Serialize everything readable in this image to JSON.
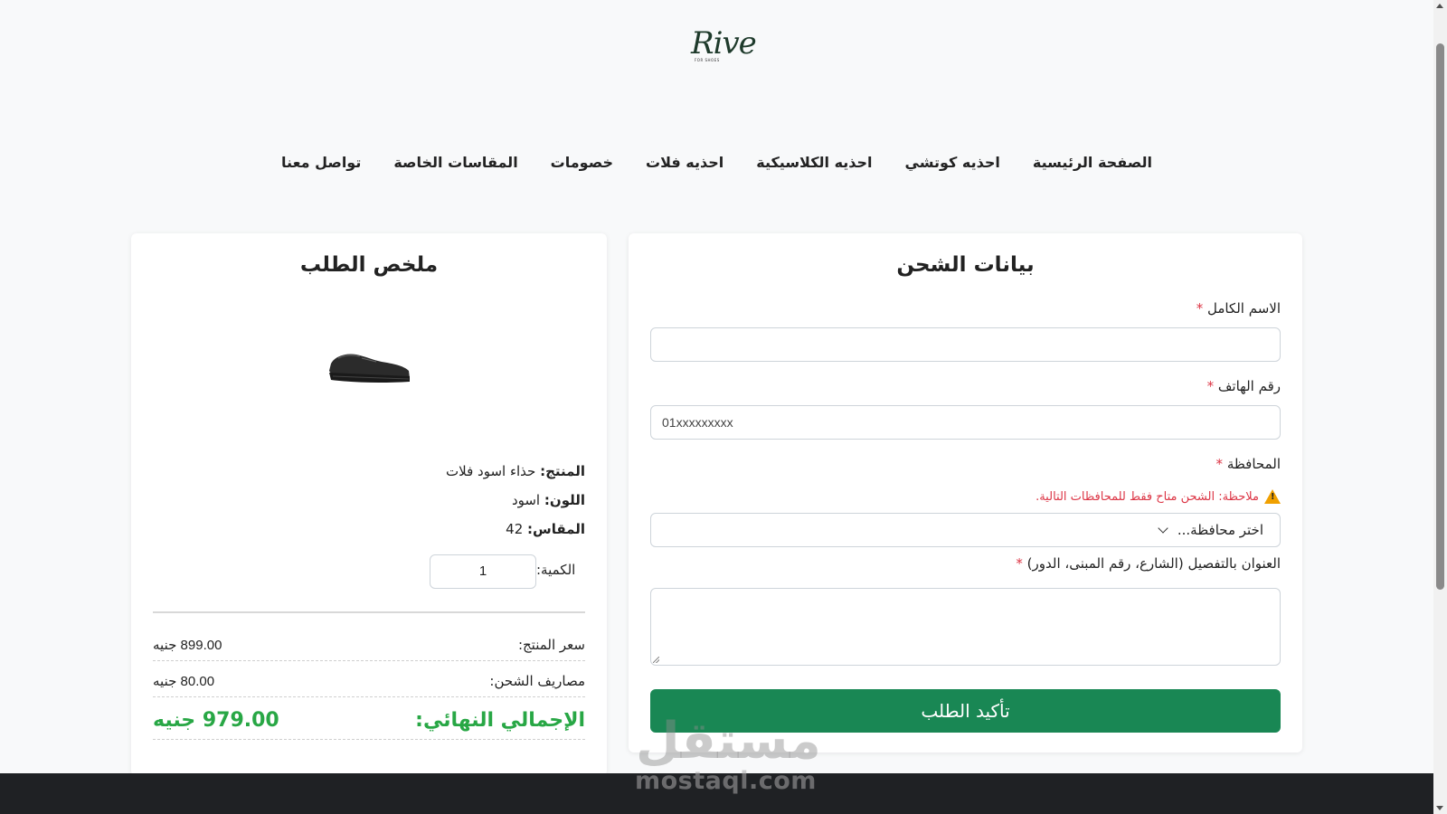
{
  "logo": {
    "text": "Rive",
    "subtext": "FOR SHOES"
  },
  "nav": {
    "items": [
      {
        "label": "الصفحة الرئيسية"
      },
      {
        "label": "احذيه كوتشي"
      },
      {
        "label": "احذيه الكلاسيكية"
      },
      {
        "label": "احذيه فلات"
      },
      {
        "label": "خصومات"
      },
      {
        "label": "المقاسات الخاصة"
      },
      {
        "label": "تواصل معنا"
      }
    ]
  },
  "shipping": {
    "title": "بيانات الشحن",
    "full_name_label": "الاسم الكامل",
    "phone_label": "رقم الهاتف",
    "phone_placeholder": "01xxxxxxxxx",
    "governorate_label": "المحافظة",
    "note": "ملاحظة: الشحن متاح فقط للمحافظات التالية.",
    "governorate_selected": "اختر محافظة...",
    "address_label": "العنوان بالتفصيل (الشارع، رقم المبنى، الدور)",
    "required_mark": "*",
    "submit_label": "تأكيد الطلب"
  },
  "summary": {
    "title": "ملخص الطلب",
    "product_key": "المنتج:",
    "product_value": "حذاء اسود فلات",
    "color_key": "اللون:",
    "color_value": "اسود",
    "size_key": "المقاس:",
    "size_value": "42",
    "qty_label": "الكمية:",
    "qty_value": "1",
    "price_label": "سعر المنتج:",
    "price_value": "899.00 جنيه",
    "shipping_label": "مصاريف الشحن:",
    "shipping_value": "80.00 جنيه",
    "total_label": "الإجمالي النهائي:",
    "total_value": "979.00 جنيه"
  },
  "watermark": {
    "arabic": "مستقل",
    "english": "mostaql.com"
  },
  "colors": {
    "primary_green": "#198754",
    "total_green": "#28a745",
    "required_red": "#dc3545",
    "footer": "#1f2124"
  }
}
